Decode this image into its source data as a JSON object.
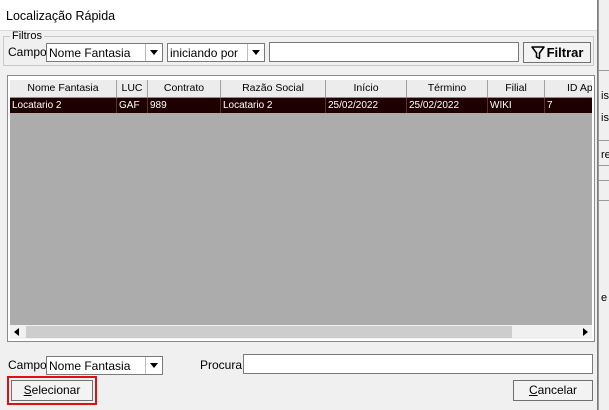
{
  "window": {
    "title": "Localização Rápida"
  },
  "filters": {
    "legend": "Filtros",
    "campo_label": "Campo:",
    "campo_value": "Nome Fantasia",
    "operator_value": "iniciando por",
    "search_value": "",
    "filter_button": "Filtrar"
  },
  "grid": {
    "columns": [
      "Nome Fantasia",
      "LUC",
      "Contrato",
      "Razão Social",
      "Início",
      "Término",
      "Filial",
      "ID Apro"
    ],
    "rows": [
      [
        "Locatario 2",
        "GAF",
        "989",
        "Locatario 2",
        "25/02/2022",
        "25/02/2022",
        "WIKI",
        "7"
      ]
    ]
  },
  "bottom": {
    "campo_label": "Campo:",
    "campo_value": "Nome Fantasia",
    "procura_label": "Procura:",
    "procura_value": "",
    "select_prefix": "S",
    "select_rest": "elecionar",
    "cancel_prefix": "C",
    "cancel_rest": "ancelar"
  },
  "background": {
    "fragments": [
      "is",
      "is",
      "re",
      "e"
    ]
  },
  "colors": {
    "selected_row": "#1e0000",
    "highlight": "#e01010",
    "grid_bg": "#acacac"
  }
}
